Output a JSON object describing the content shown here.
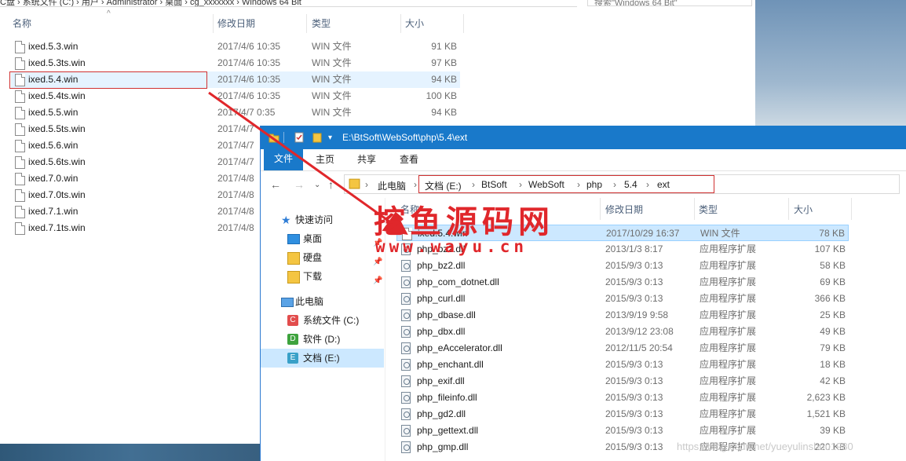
{
  "back_window": {
    "breadcrumb_fragment": "C盘  ›  系统文件 (C:)  ›  用户  ›  Administrator  ›  桌面  ›  cg_xxxxxxx  ›  Windows 64 Bit",
    "search_placeholder": "搜索\"Windows 64 Bit\"",
    "columns": {
      "name": "名称",
      "date": "修改日期",
      "type": "类型",
      "size": "大小"
    },
    "files": [
      {
        "name": "ixed.5.3.win",
        "date": "2017/4/6 10:35",
        "type": "WIN 文件",
        "size": "91 KB"
      },
      {
        "name": "ixed.5.3ts.win",
        "date": "2017/4/6 10:35",
        "type": "WIN 文件",
        "size": "97 KB"
      },
      {
        "name": "ixed.5.4.win",
        "date": "2017/4/6 10:35",
        "type": "WIN 文件",
        "size": "94 KB"
      },
      {
        "name": "ixed.5.4ts.win",
        "date": "2017/4/6 10:35",
        "type": "WIN 文件",
        "size": "100 KB"
      },
      {
        "name": "ixed.5.5.win",
        "date": "2017/4/7 0:35",
        "type": "WIN 文件",
        "size": "94 KB"
      },
      {
        "name": "ixed.5.5ts.win",
        "date": "2017/4/7",
        "type": "",
        "size": ""
      },
      {
        "name": "ixed.5.6.win",
        "date": "2017/4/7",
        "type": "",
        "size": ""
      },
      {
        "name": "ixed.5.6ts.win",
        "date": "2017/4/7",
        "type": "",
        "size": ""
      },
      {
        "name": "ixed.7.0.win",
        "date": "2017/4/8",
        "type": "",
        "size": ""
      },
      {
        "name": "ixed.7.0ts.win",
        "date": "2017/4/8",
        "type": "",
        "size": ""
      },
      {
        "name": "ixed.7.1.win",
        "date": "2017/4/8",
        "type": "",
        "size": ""
      },
      {
        "name": "ixed.7.1ts.win",
        "date": "2017/4/8",
        "type": "",
        "size": ""
      }
    ]
  },
  "front_window": {
    "title": "E:\\BtSoft\\WebSoft\\php\\5.4\\ext",
    "ribbon_tabs": [
      "文件",
      "主页",
      "共享",
      "查看"
    ],
    "address": {
      "this_pc": "此电脑",
      "crumbs": [
        "文档 (E:)",
        "BtSoft",
        "WebSoft",
        "php",
        "5.4",
        "ext"
      ]
    },
    "nav_pane": {
      "quick_access": "快速访问",
      "items": [
        "桌面",
        "硬盘",
        "下载"
      ],
      "this_pc": "此电脑",
      "drives": [
        "系统文件 (C:)",
        "软件 (D:)",
        "文档 (E:)"
      ]
    },
    "columns": {
      "name": "名称",
      "date": "修改日期",
      "type": "类型",
      "size": "大小"
    },
    "files": [
      {
        "name": "ixed.5.4.win",
        "date": "2017/10/29 16:37",
        "type": "WIN 文件",
        "size": "78 KB"
      },
      {
        "name": "php_bz2.dll",
        "date": "2013/1/3 8:17",
        "type": "应用程序扩展",
        "size": "107 KB"
      },
      {
        "name": "php_bz2.dll",
        "date": "2015/9/3 0:13",
        "type": "应用程序扩展",
        "size": "58 KB"
      },
      {
        "name": "php_com_dotnet.dll",
        "date": "2015/9/3 0:13",
        "type": "应用程序扩展",
        "size": "69 KB"
      },
      {
        "name": "php_curl.dll",
        "date": "2015/9/3 0:13",
        "type": "应用程序扩展",
        "size": "366 KB"
      },
      {
        "name": "php_dbase.dll",
        "date": "2013/9/19 9:58",
        "type": "应用程序扩展",
        "size": "25 KB"
      },
      {
        "name": "php_dbx.dll",
        "date": "2013/9/12 23:08",
        "type": "应用程序扩展",
        "size": "49 KB"
      },
      {
        "name": "php_eAccelerator.dll",
        "date": "2012/11/5 20:54",
        "type": "应用程序扩展",
        "size": "79 KB"
      },
      {
        "name": "php_enchant.dll",
        "date": "2015/9/3 0:13",
        "type": "应用程序扩展",
        "size": "18 KB"
      },
      {
        "name": "php_exif.dll",
        "date": "2015/9/3 0:13",
        "type": "应用程序扩展",
        "size": "42 KB"
      },
      {
        "name": "php_fileinfo.dll",
        "date": "2015/9/3 0:13",
        "type": "应用程序扩展",
        "size": "2,623 KB"
      },
      {
        "name": "php_gd2.dll",
        "date": "2015/9/3 0:13",
        "type": "应用程序扩展",
        "size": "1,521 KB"
      },
      {
        "name": "php_gettext.dll",
        "date": "2015/9/3 0:13",
        "type": "应用程序扩展",
        "size": "39 KB"
      },
      {
        "name": "php_gmp.dll",
        "date": "2015/9/3 0:13",
        "type": "应用程序扩展",
        "size": "220 KB"
      }
    ]
  },
  "watermark": {
    "line1": "挖鱼源码网",
    "line2": "www.wayu.cn",
    "blog": "https://blog.csdn.net/yueyulinshou1980"
  },
  "colors": {
    "accent": "#1979ca",
    "highlight": "#d03030"
  }
}
